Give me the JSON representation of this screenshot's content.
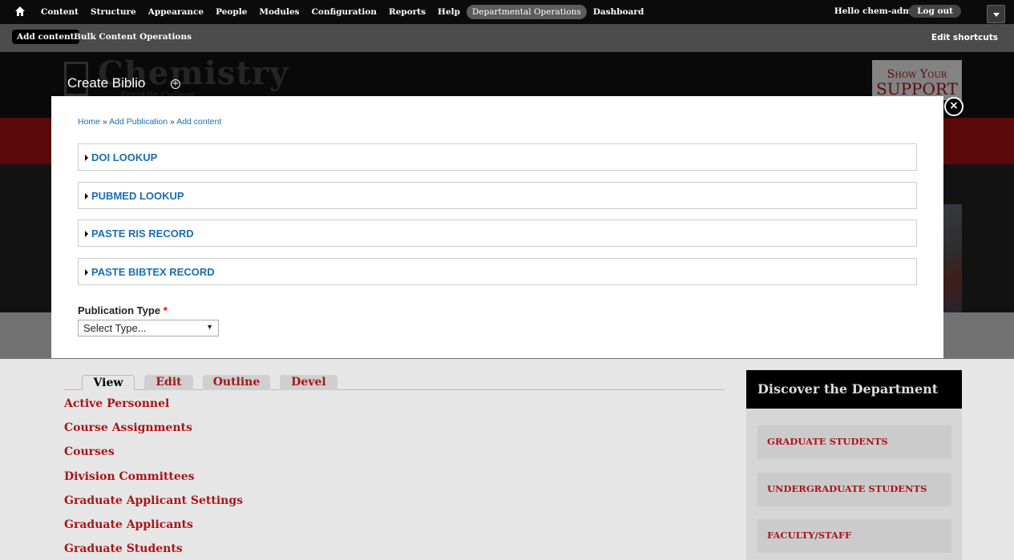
{
  "toolbar": {
    "home_icon": "home-icon",
    "menu": [
      "Content",
      "Structure",
      "Appearance",
      "People",
      "Modules",
      "Configuration",
      "Reports",
      "Help",
      "Departmental Operations",
      "Dashboard"
    ],
    "active_item": "Departmental Operations",
    "greeting": "Hello chem-admin",
    "logout": "Log out"
  },
  "shortcuts": {
    "add_content": "Add content",
    "bulk": "Bulk Content Operations",
    "edit_shortcuts": "Edit shortcuts"
  },
  "site": {
    "logo_text": "Chemistry",
    "logo_sub": "Franklin College",
    "support_line1": "Show Your",
    "support_line2": "SUPPORT"
  },
  "modal": {
    "title": "Create Biblio",
    "close_icon": "close-icon",
    "breadcrumb": {
      "items": [
        "Home",
        "Add Publication",
        "Add content"
      ],
      "separator": "»"
    },
    "fieldsets": [
      "DOI LOOKUP",
      "PUBMED LOOKUP",
      "PASTE RIS RECORD",
      "PASTE BIBTEX RECORD"
    ],
    "publication_type_label": "Publication Type",
    "required_marker": "*",
    "publication_type_value": "Select Type..."
  },
  "page": {
    "tabs": [
      "View",
      "Edit",
      "Outline",
      "Devel"
    ],
    "active_tab": "View",
    "links": [
      "Active Personnel",
      "Course Assignments",
      "Courses",
      "Division Committees",
      "Graduate Applicant Settings",
      "Graduate Applicants",
      "Graduate Students"
    ],
    "discover": {
      "title": "Discover the Department",
      "items": [
        "GRADUATE STUDENTS",
        "UNDERGRADUATE STUDENTS",
        "FACULTY/STAFF"
      ]
    }
  },
  "colors": {
    "brand_red": "#a5120f",
    "link_blue": "#1a6db4"
  }
}
